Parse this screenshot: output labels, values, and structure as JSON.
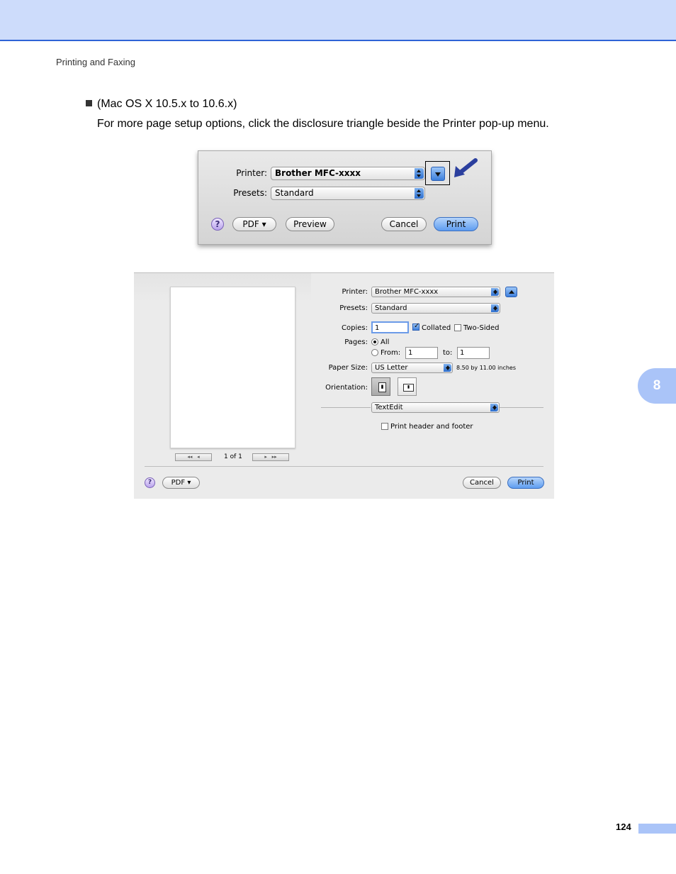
{
  "header": {
    "section": "Printing and Faxing"
  },
  "content": {
    "bullet": "(Mac OS X 10.5.x to 10.6.x)",
    "instruction": "For more page setup options, click the disclosure triangle beside the Printer pop-up menu."
  },
  "dialog_small": {
    "printer_label": "Printer:",
    "printer_value": "Brother MFC-xxxx",
    "presets_label": "Presets:",
    "presets_value": "Standard",
    "help": "?",
    "pdf": "PDF ▾",
    "preview": "Preview",
    "cancel": "Cancel",
    "print": "Print"
  },
  "dialog_large": {
    "printer_label": "Printer:",
    "printer_value": "Brother MFC-xxxx",
    "presets_label": "Presets:",
    "presets_value": "Standard",
    "copies_label": "Copies:",
    "copies_value": "1",
    "collated": "Collated",
    "collated_checked": true,
    "two_sided": "Two-Sided",
    "pages_label": "Pages:",
    "pages_all": "All",
    "pages_from": "From:",
    "from_value": "1",
    "to_label": "to:",
    "to_value": "1",
    "paper_size_label": "Paper Size:",
    "paper_size_value": "US Letter",
    "paper_size_dims": "8.50 by 11.00 inches",
    "orientation_label": "Orientation:",
    "app_menu": "TextEdit",
    "header_footer": "Print header and footer",
    "page_indicator": "1 of 1",
    "help": "?",
    "pdf": "PDF ▾",
    "cancel": "Cancel",
    "print": "Print"
  },
  "chapter_tab": "8",
  "footer": {
    "page_number": "124"
  },
  "colors": {
    "accent": "#2e63d6",
    "band": "#cddcfb",
    "tab": "#aac4f8",
    "arrow": "#2b3f9e"
  }
}
